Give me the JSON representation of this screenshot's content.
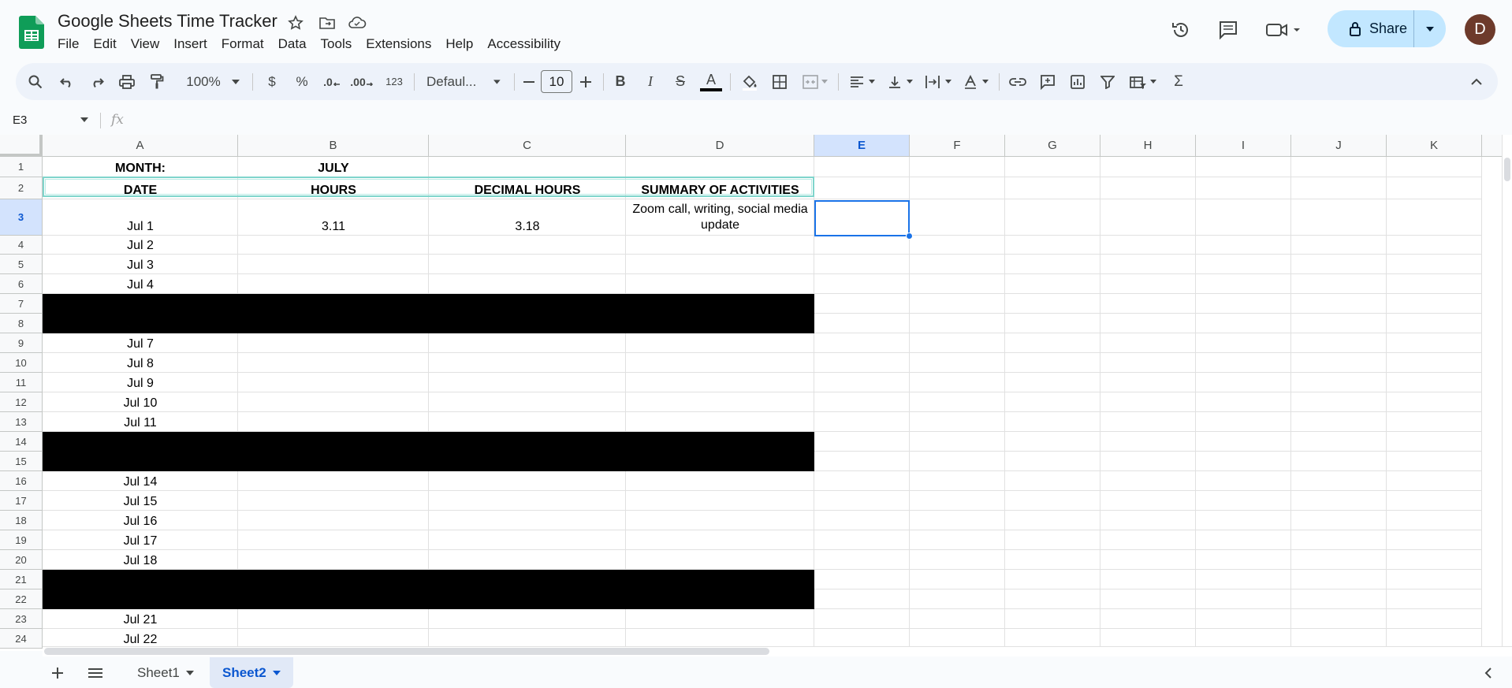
{
  "app": {
    "title": "Google Sheets Time Tracker",
    "menus": [
      "File",
      "Edit",
      "View",
      "Insert",
      "Format",
      "Data",
      "Tools",
      "Extensions",
      "Help",
      "Accessibility"
    ],
    "share_label": "Share",
    "avatar_initial": "D"
  },
  "toolbar": {
    "zoom": "100%",
    "currency": "$",
    "percent": "%",
    "dec_decrease": ".0",
    "dec_increase": ".00",
    "number_format": "123",
    "font": "Defaul...",
    "font_size": "10",
    "bold": "B",
    "italic": "I",
    "strike": "S",
    "text_color": "A",
    "sum": "Σ"
  },
  "formula_bar": {
    "cell_ref": "E3",
    "fx": "fx",
    "value": ""
  },
  "grid": {
    "columns": [
      "A",
      "B",
      "C",
      "D",
      "E",
      "F",
      "G",
      "H",
      "I",
      "J",
      "K"
    ],
    "selected_column": "E",
    "selected_row": "3",
    "rows": [
      "1",
      "2",
      "3",
      "4",
      "5",
      "6",
      "7",
      "8",
      "9",
      "10",
      "11",
      "12",
      "13",
      "14",
      "15",
      "16",
      "17",
      "18",
      "19",
      "20",
      "21",
      "22",
      "23",
      "24"
    ],
    "row1": {
      "a": "MONTH:",
      "b": "JULY"
    },
    "header": {
      "a": "DATE",
      "b": "HOURS",
      "c": "DECIMAL HOURS",
      "d": "SUMMARY OF ACTIVITIES"
    },
    "row3": {
      "a": "Jul 1",
      "b": "3.11",
      "c": "3.18",
      "d": "Zoom call, writing, social media update"
    },
    "dates": {
      "r4": "Jul 2",
      "r5": "Jul 3",
      "r6": "Jul 4",
      "r9": "Jul 7",
      "r10": "Jul 8",
      "r11": "Jul 9",
      "r12": "Jul 10",
      "r13": "Jul 11",
      "r16": "Jul 14",
      "r17": "Jul 15",
      "r18": "Jul 16",
      "r19": "Jul 17",
      "r20": "Jul 18",
      "r23": "Jul 21",
      "r24": "Jul 22"
    }
  },
  "sheets": {
    "tabs": [
      "Sheet1",
      "Sheet2"
    ],
    "active": "Sheet2"
  },
  "colors": {
    "accent": "#0b57d0",
    "share_bg": "#c2e7ff",
    "weekend_band": "#000000",
    "header_outline": "#7fd5cc"
  }
}
